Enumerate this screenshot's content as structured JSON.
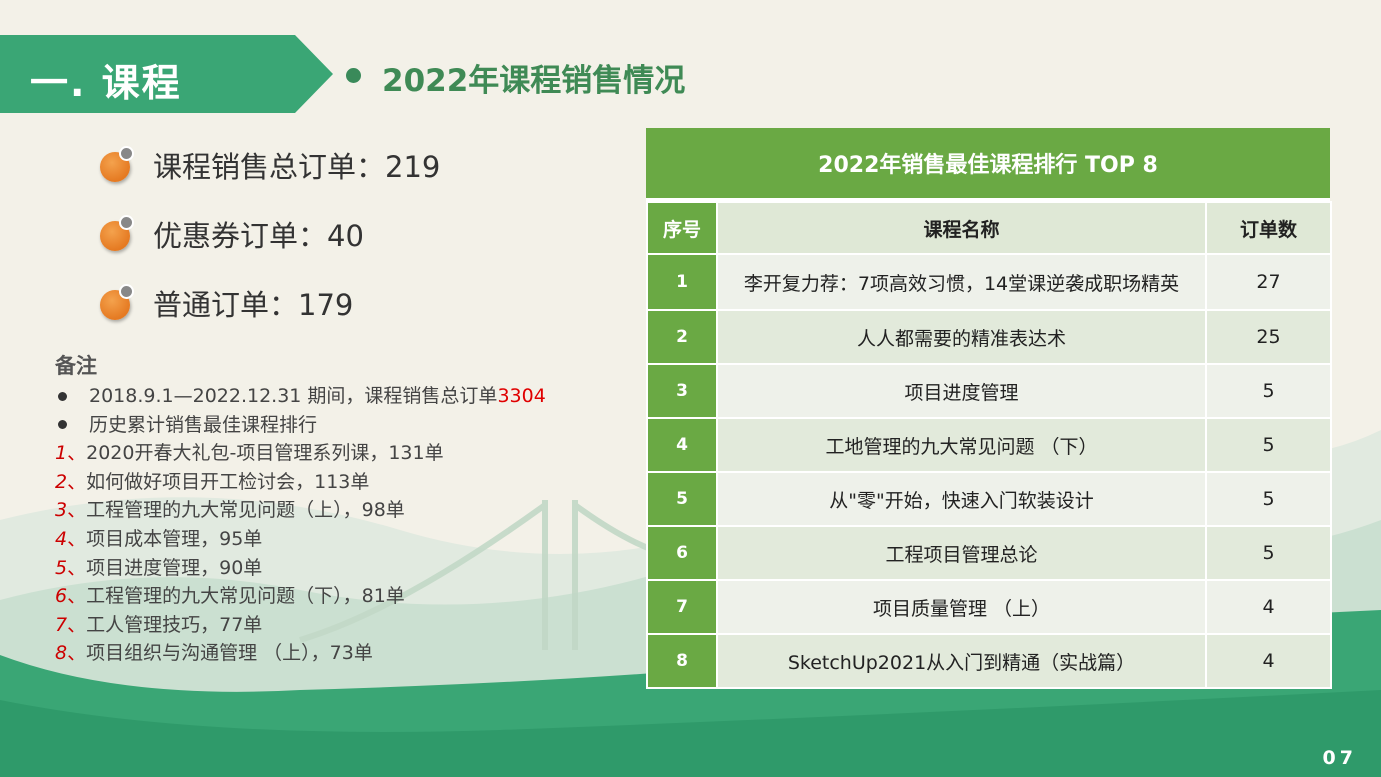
{
  "section": {
    "title": "一. 课程"
  },
  "subtitle": "2022年课程销售情况",
  "stats": [
    {
      "text": "课程销售总订单：219"
    },
    {
      "text": "优惠券订单：40"
    },
    {
      "text": "普通订单：179"
    }
  ],
  "notes": {
    "title": "备注",
    "bullets": [
      {
        "text": "2018.9.1—2022.12.31 期间，课程销售总订单",
        "highlight": "3304"
      },
      {
        "text": "历史累计销售最佳课程排行",
        "highlight": ""
      }
    ],
    "items": [
      {
        "num": "1",
        "text": "2020开春大礼包-项目管理系列课，131单"
      },
      {
        "num": "2",
        "text": "如何做好项目开工检讨会，113单"
      },
      {
        "num": "3",
        "text": "工程管理的九大常见问题（上），98单"
      },
      {
        "num": "4",
        "text": "项目成本管理，95单"
      },
      {
        "num": "5",
        "text": "项目进度管理，90单"
      },
      {
        "num": "6",
        "text": "工程管理的九大常见问题（下），81单"
      },
      {
        "num": "7",
        "text": "工人管理技巧，77单"
      },
      {
        "num": "8",
        "text": "项目组织与沟通管理 （上），73单"
      }
    ]
  },
  "ranking": {
    "title": "2022年销售最佳课程排行 TOP 8",
    "headers": [
      "序号",
      "课程名称",
      "订单数"
    ],
    "rows": [
      {
        "idx": "1",
        "name": "李开复力荐：7项高效习惯，14堂课逆袭成职场精英",
        "orders": "27"
      },
      {
        "idx": "2",
        "name": "人人都需要的精准表达术",
        "orders": "25"
      },
      {
        "idx": "3",
        "name": "项目进度管理",
        "orders": "5"
      },
      {
        "idx": "4",
        "name": "工地管理的九大常见问题 （下）",
        "orders": "5"
      },
      {
        "idx": "5",
        "name": "从\"零\"开始，快速入门软装设计",
        "orders": "5"
      },
      {
        "idx": "6",
        "name": "工程项目管理总论",
        "orders": "5"
      },
      {
        "idx": "7",
        "name": "项目质量管理 （上）",
        "orders": "4"
      },
      {
        "idx": "8",
        "name": "SketchUp2021从入门到精通（实战篇）",
        "orders": "4"
      }
    ]
  },
  "page_number": "07"
}
